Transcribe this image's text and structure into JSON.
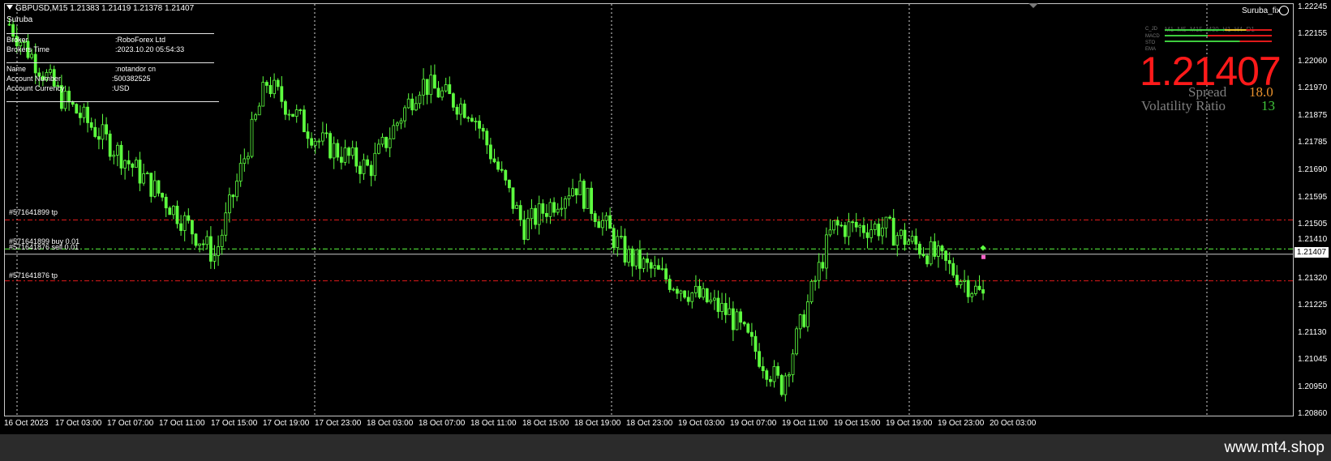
{
  "header": {
    "symbol_info": "GBPUSD,M15  1.21383 1.21419 1.21378 1.21407",
    "ea_name": "Suruba",
    "ea_badge": "Suruba_fix"
  },
  "info_panel": {
    "broker_label": "Broker",
    "broker_value": ":RoboForex Ltd",
    "time_label": "Brokers Time",
    "time_value": ":2023.10.20 05:54:33",
    "name_label": "Name",
    "name_value": ":notandor cn",
    "account_label": "Account Number",
    "account_value": ":500382525",
    "currency_label": "Account Currency",
    "currency_value": ":USD"
  },
  "orders": {
    "tp_upper": "#571641899 tp",
    "buy": "#571641899 buy 0.01",
    "sell": "#571641876 sell 0.01",
    "tp_lower": "#571641876 tp"
  },
  "indicator": {
    "rows": [
      "C_JD",
      "MACD",
      "STO",
      "EMA"
    ],
    "timeframes": [
      "M1",
      "M5",
      "M15",
      "M30",
      "H1",
      "H4",
      "D1"
    ]
  },
  "panel": {
    "price": "1.21407",
    "spread_label": "Spread",
    "spread_value": "18.0",
    "vol_label": "Volatility Ratio",
    "vol_value": "13"
  },
  "price_axis": {
    "labels": [
      "1.22245",
      "1.22155",
      "1.22060",
      "1.21970",
      "1.21875",
      "1.21785",
      "1.21690",
      "1.21595",
      "1.21505",
      "1.21410",
      "1.21320",
      "1.21225",
      "1.21130",
      "1.21045",
      "1.20950",
      "1.20860"
    ],
    "current": "1.21407"
  },
  "time_axis": {
    "labels": [
      "16 Oct 2023",
      "17 Oct 03:00",
      "17 Oct 07:00",
      "17 Oct 11:00",
      "17 Oct 15:00",
      "17 Oct 19:00",
      "17 Oct 23:00",
      "18 Oct 03:00",
      "18 Oct 07:00",
      "18 Oct 11:00",
      "18 Oct 15:00",
      "18 Oct 19:00",
      "18 Oct 23:00",
      "19 Oct 03:00",
      "19 Oct 07:00",
      "19 Oct 11:00",
      "19 Oct 15:00",
      "19 Oct 19:00",
      "19 Oct 23:00",
      "20 Oct 03:00"
    ]
  },
  "footer": {
    "watermark": "www.mt4.shop"
  },
  "chart_data": {
    "type": "line",
    "ylim": [
      1.2085,
      1.2227
    ],
    "x": [
      "16 Oct 2023",
      "17 Oct 03:00",
      "17 Oct 07:00",
      "17 Oct 11:00",
      "17 Oct 15:00",
      "17 Oct 19:00",
      "17 Oct 23:00",
      "18 Oct 03:00",
      "18 Oct 07:00",
      "18 Oct 11:00",
      "18 Oct 15:00",
      "18 Oct 19:00",
      "18 Oct 23:00",
      "19 Oct 03:00",
      "19 Oct 07:00",
      "19 Oct 11:00",
      "19 Oct 15:00",
      "19 Oct 19:00",
      "19 Oct 23:00",
      "20 Oct 03:00"
    ],
    "series": [
      {
        "values": [
          1.222,
          1.2195,
          1.2178,
          1.216,
          1.214,
          1.22,
          1.218,
          1.217,
          1.22,
          1.219,
          1.215,
          1.2165,
          1.214,
          1.213,
          1.212,
          1.2095,
          1.215,
          1.215,
          1.214,
          1.2125
        ]
      }
    ],
    "levels": {
      "tp_upper": 1.21525,
      "buy": 1.21425,
      "sell": 1.21407,
      "tp_lower": 1.21315,
      "current": 1.21407
    },
    "colors": {
      "candles": "#5dff3f",
      "tp": "#e01a1a",
      "buy": "#5dff3f",
      "sell": "#c8c8c8",
      "big_price": "#ff1a1a",
      "spread_value": "#e8912d",
      "vol_value": "#41c83b"
    },
    "grid": true
  }
}
